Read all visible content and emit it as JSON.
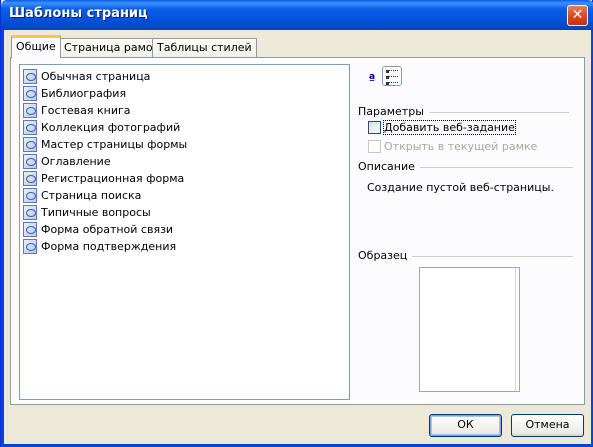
{
  "window": {
    "title": "Шаблоны страниц",
    "close_label": "✕"
  },
  "tabs": [
    {
      "label": "Общие",
      "active": true
    },
    {
      "label": "Страница рамок",
      "active": false
    },
    {
      "label": "Таблицы стилей",
      "active": false
    }
  ],
  "templates": [
    "Обычная страница",
    "Библиография",
    "Гостевая книга",
    "Коллекция фотографий",
    "Мастер страницы формы",
    "Оглавление",
    "Регистрационная форма",
    "Страница поиска",
    "Типичные вопросы",
    "Форма обратной связи",
    "Форма подтверждения"
  ],
  "view_buttons": {
    "small_icons": "a̲",
    "details": ""
  },
  "options": {
    "header": "Параметры",
    "add_web_task": {
      "label": "Добавить веб-задание",
      "checked": false,
      "enabled": true
    },
    "open_in_frame": {
      "label": "Открыть в текущей рамке",
      "checked": false,
      "enabled": false
    }
  },
  "description": {
    "header": "Описание",
    "text": "Создание пустой веб-страницы."
  },
  "preview": {
    "header": "Образец"
  },
  "buttons": {
    "ok": "ОК",
    "cancel": "Отмена"
  },
  "colors": {
    "title_bar": "#0553e0",
    "dialog_bg": "#ece9d8",
    "tab_highlight": "#ffc83c"
  }
}
